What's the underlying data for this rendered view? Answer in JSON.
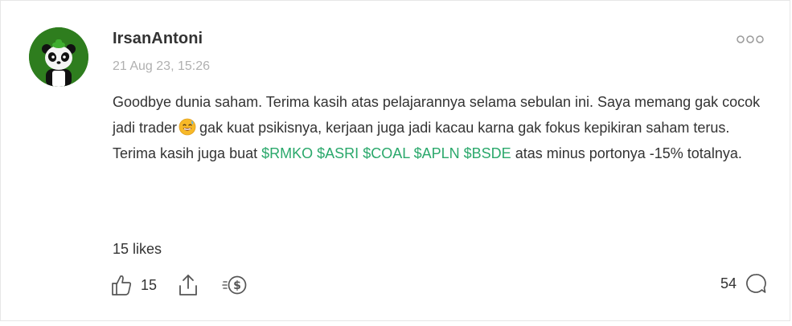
{
  "post": {
    "author": "IrsanAntoni",
    "timestamp": "21 Aug 23, 15:26",
    "avatar_icon": "panda-avatar",
    "body": {
      "line1_before_emoji": "Goodbye dunia saham. Terima kasih atas pelajarannya selama sebulan ini. Saya memang gak cocok jadi trader",
      "emoji": "smiling-face-with-sweat-emoji",
      "line1_after_emoji": "gak kuat psikisnya, kerjaan juga jadi kacau karna gak fokus kepikiran saham terus.",
      "line2_before_tickers": "Terima kasih juga buat",
      "tickers": [
        "$RMKO",
        "$ASRI",
        "$COAL",
        "$APLN",
        "$BSDE"
      ],
      "line2_after_tickers": "atas minus portonya -15% totalnya."
    },
    "likes_label": "15 likes",
    "actions": {
      "like_count": "15",
      "comment_count": "54"
    },
    "colors": {
      "ticker": "#2aa86b",
      "text": "#333333",
      "muted": "#b0b0b0",
      "avatar_bg": "#2e7d1e"
    }
  }
}
